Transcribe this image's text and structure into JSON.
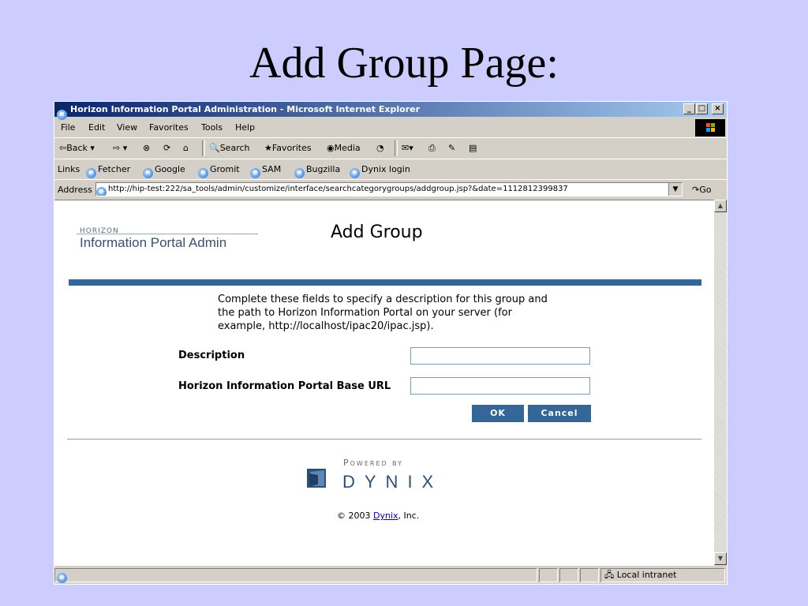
{
  "slide": {
    "title": "Add Group Page:"
  },
  "window": {
    "title": "Horizon Information Portal Administration - Microsoft Internet Explorer",
    "buttons": {
      "minimize": "_",
      "maximize": "□",
      "close": "×"
    }
  },
  "menu": {
    "items": [
      {
        "label": "File"
      },
      {
        "label": "Edit"
      },
      {
        "label": "View"
      },
      {
        "label": "Favorites"
      },
      {
        "label": "Tools"
      },
      {
        "label": "Help"
      }
    ]
  },
  "toolbar": {
    "back": "Back",
    "search": "Search",
    "favorites": "Favorites",
    "media": "Media"
  },
  "links": {
    "label": "Links",
    "items": [
      {
        "label": "Fetcher"
      },
      {
        "label": "Google"
      },
      {
        "label": "Gromit"
      },
      {
        "label": "SAM"
      },
      {
        "label": "Bugzilla"
      },
      {
        "label": "Dynix login"
      }
    ]
  },
  "address": {
    "label": "Address",
    "url": "http://hip-test:222/sa_tools/admin/customize/interface/searchcategorygroups/addgroup.jsp?&date=1112812399837",
    "go": "Go"
  },
  "page": {
    "logo_small": "HORIZON",
    "logo_big": "Information Portal Admin",
    "heading": "Add Group",
    "intro": "Complete these fields to specify a description for this group and the path to Horizon Information Portal on your server (for example, http://localhost/ipac20/ipac.jsp).",
    "form": {
      "description_label": "Description",
      "description_value": "",
      "url_label": "Horizon Information Portal Base URL",
      "url_value": ""
    },
    "ok_label": "OK",
    "cancel_label": "Cancel",
    "powered_by": "Powered by",
    "brand": "DYNIX",
    "copyright_prefix": "© 2003 ",
    "copyright_link": "Dynix",
    "copyright_suffix": ", Inc."
  },
  "status": {
    "zone": "Local intranet"
  },
  "colors": {
    "slide_bg": "#ccccff",
    "accent": "#336699",
    "titlebar": "#0a246a"
  }
}
